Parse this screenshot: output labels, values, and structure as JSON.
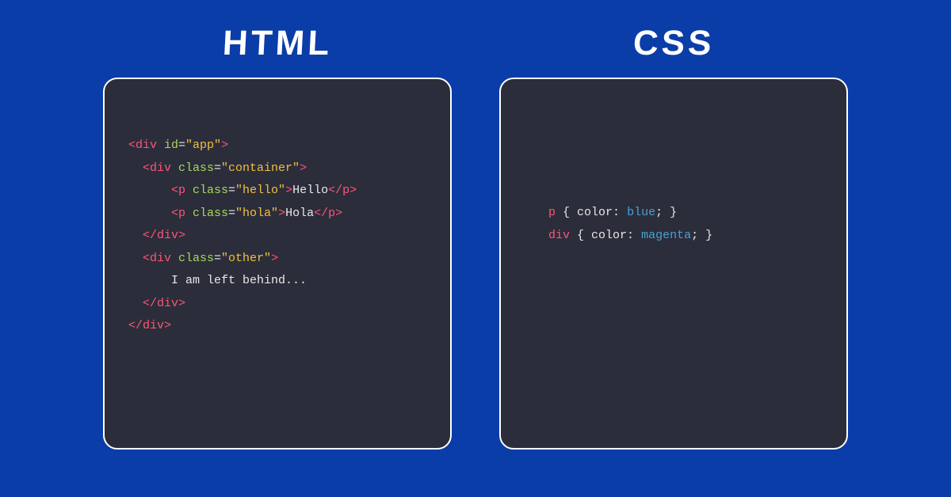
{
  "left": {
    "title": "HTML",
    "code": {
      "l1": {
        "tag_open": "<div ",
        "attr": "id",
        "eq": "=",
        "val": "\"app\"",
        "close": ">"
      },
      "l2": {
        "tag_open": "<div ",
        "attr": "class",
        "eq": "=",
        "val": "\"container\"",
        "close": ">"
      },
      "l3": {
        "tag_open": "<p ",
        "attr": "class",
        "eq": "=",
        "val": "\"hello\"",
        "close": ">",
        "text": "Hello",
        "tag_close": "</p>"
      },
      "l4": {
        "tag_open": "<p ",
        "attr": "class",
        "eq": "=",
        "val": "\"hola\"",
        "close": ">",
        "text": "Hola",
        "tag_close": "</p>"
      },
      "l5": {
        "tag_close": "</div>"
      },
      "l6": {
        "tag_open": "<div ",
        "attr": "class",
        "eq": "=",
        "val": "\"other\"",
        "close": ">"
      },
      "l7": {
        "text": "I am left behind..."
      },
      "l8": {
        "tag_close": "</div>"
      },
      "l9": {
        "tag_close": "</div>"
      }
    }
  },
  "right": {
    "title": "CSS",
    "code": {
      "l1": {
        "sel": "p ",
        "ob": "{ ",
        "prop": "color",
        "colon": ": ",
        "val": "blue",
        "semi": "; ",
        "cb": "}"
      },
      "l2": {
        "sel": "div ",
        "ob": "{ ",
        "prop": "color",
        "colon": ": ",
        "val": "magenta",
        "semi": "; ",
        "cb": "}"
      }
    }
  }
}
